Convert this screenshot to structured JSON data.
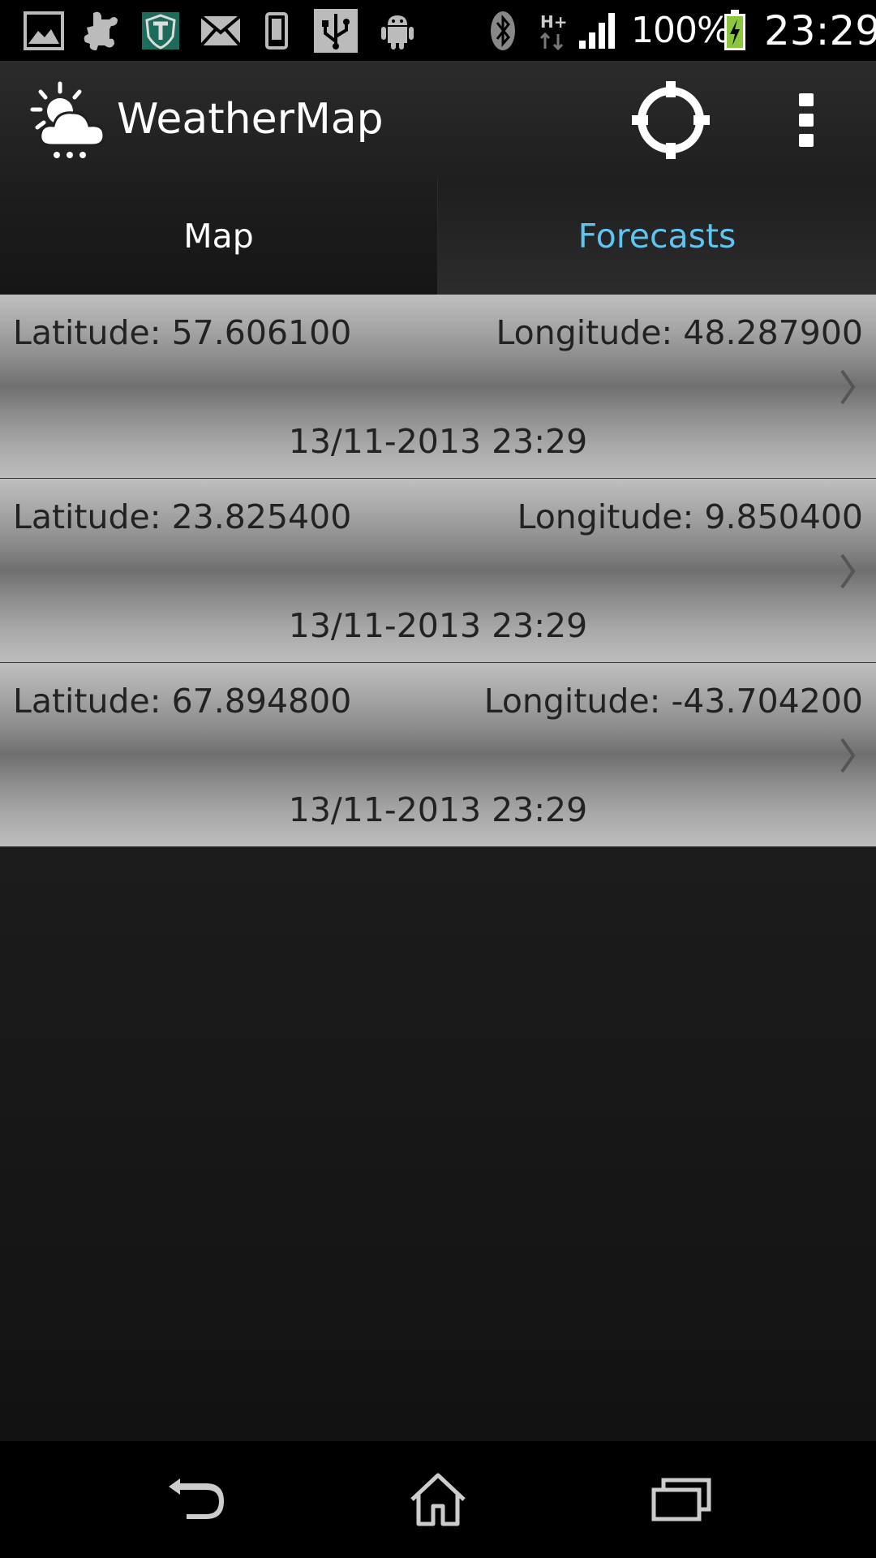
{
  "status_bar": {
    "battery_percent": "100%",
    "clock": "23:29",
    "network_type": "H+",
    "icons": [
      "gallery-icon",
      "puzzle-icon",
      "shield-t-icon",
      "mail-icon",
      "phone-icon",
      "usb-icon",
      "android-icon",
      "bluetooth-icon",
      "network-data-icon",
      "signal-icon",
      "battery-charging-icon"
    ]
  },
  "action_bar": {
    "title": "WeatherMap",
    "logo_icon": "weather-cloud-sun-icon",
    "locate_icon": "crosshair-locate-icon",
    "overflow_icon": "overflow-menu-icon"
  },
  "tabs": [
    {
      "label": "Map",
      "selected": false
    },
    {
      "label": "Forecasts",
      "selected": true
    }
  ],
  "forecasts": [
    {
      "latitude": "Latitude: 57.606100",
      "longitude": "Longitude: 48.287900",
      "date": "13/11-2013 23:29"
    },
    {
      "latitude": "Latitude: 23.825400",
      "longitude": "Longitude: 9.850400",
      "date": "13/11-2013 23:29"
    },
    {
      "latitude": "Latitude: 67.894800",
      "longitude": "Longitude: -43.704200",
      "date": "13/11-2013 23:29"
    }
  ],
  "nav_bar": {
    "icons": [
      "back-icon",
      "home-icon",
      "recent-apps-icon"
    ]
  },
  "colors": {
    "accent": "#5fc4f0",
    "text_dark": "#222222",
    "action_bar": "#2b2b2b"
  }
}
